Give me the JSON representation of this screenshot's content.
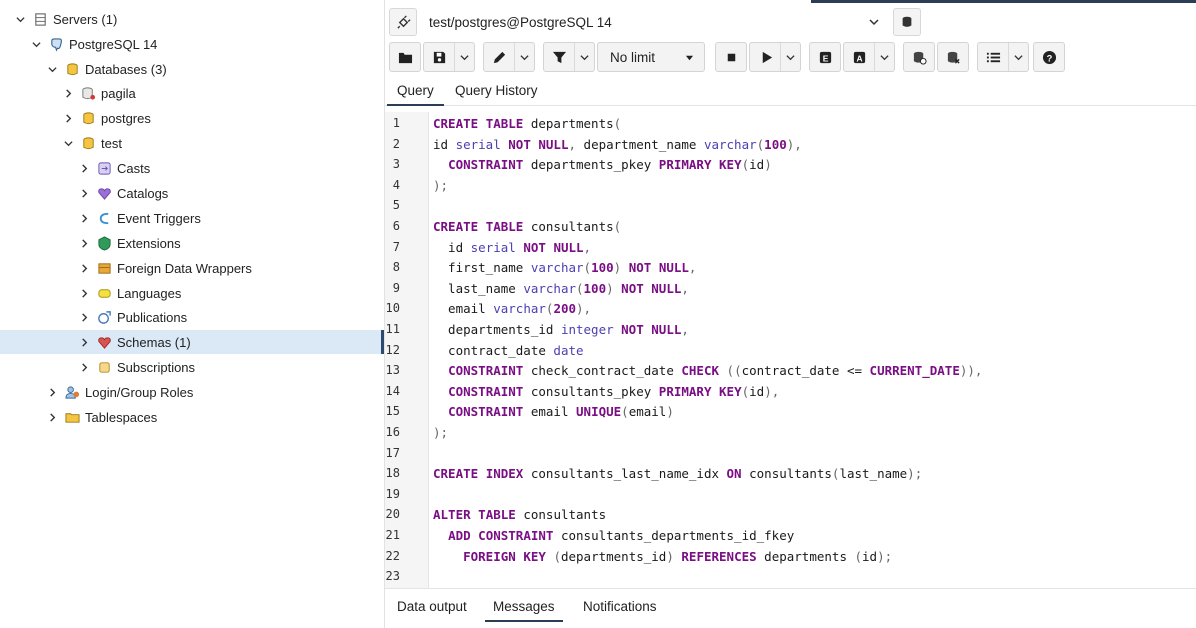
{
  "tree": {
    "items": [
      {
        "label": "Servers (1)"
      },
      {
        "label": "PostgreSQL 14"
      },
      {
        "label": "Databases (3)"
      },
      {
        "label": "pagila"
      },
      {
        "label": "postgres"
      },
      {
        "label": "test"
      },
      {
        "label": "Casts"
      },
      {
        "label": "Catalogs"
      },
      {
        "label": "Event Triggers"
      },
      {
        "label": "Extensions"
      },
      {
        "label": "Foreign Data Wrappers"
      },
      {
        "label": "Languages"
      },
      {
        "label": "Publications"
      },
      {
        "label": "Schemas (1)"
      },
      {
        "label": "Subscriptions"
      },
      {
        "label": "Login/Group Roles"
      },
      {
        "label": "Tablespaces"
      }
    ]
  },
  "connection": {
    "label": "test/postgres@PostgreSQL 14"
  },
  "toolbar": {
    "limit_label": "No limit"
  },
  "editor_tabs": [
    {
      "label": "Query"
    },
    {
      "label": "Query History"
    }
  ],
  "editor": {
    "line_numbers": [
      "1",
      "2",
      "3",
      "4",
      "5",
      "6",
      "7",
      "8",
      "9",
      "10",
      "11",
      "12",
      "13",
      "14",
      "15",
      "16",
      "17",
      "18",
      "19",
      "20",
      "21",
      "22",
      "23"
    ],
    "lines": [
      "CREATE TABLE departments(",
      "id serial NOT NULL, department_name varchar(100),",
      "  CONSTRAINT departments_pkey PRIMARY KEY(id)",
      ");",
      "",
      "CREATE TABLE consultants(",
      "  id serial NOT NULL,",
      "  first_name varchar(100) NOT NULL,",
      "  last_name varchar(100) NOT NULL,",
      "  email varchar(200),",
      "  departments_id integer NOT NULL,",
      "  contract_date date",
      "  CONSTRAINT check_contract_date CHECK ((contract_date <= CURRENT_DATE)),",
      "  CONSTRAINT consultants_pkey PRIMARY KEY(id),",
      "  CONSTRAINT email UNIQUE(email)",
      ");",
      "",
      "CREATE INDEX consultants_last_name_idx ON consultants(last_name);",
      "",
      "ALTER TABLE consultants",
      "  ADD CONSTRAINT consultants_departments_id_fkey",
      "    FOREIGN KEY (departments_id) REFERENCES departments (id);",
      ""
    ]
  },
  "output_tabs": [
    {
      "label": "Data output"
    },
    {
      "label": "Messages"
    },
    {
      "label": "Notifications"
    }
  ]
}
